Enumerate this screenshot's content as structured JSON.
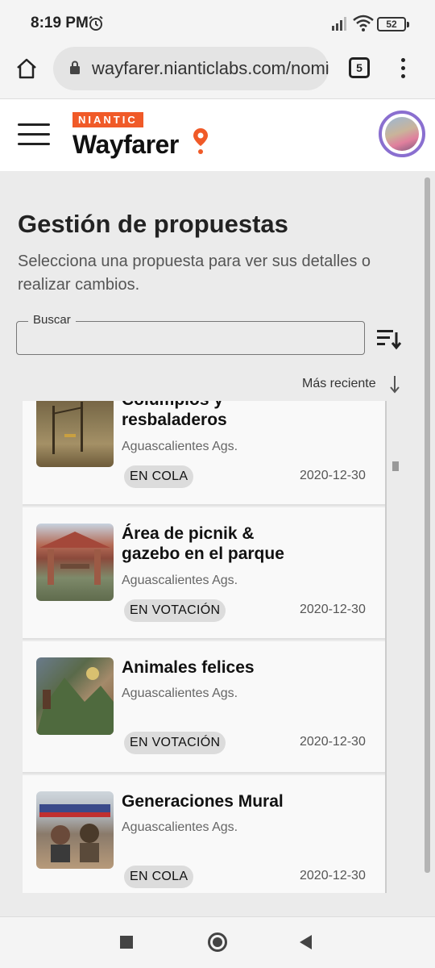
{
  "status_bar": {
    "time": "8:19 PM",
    "battery": "52"
  },
  "browser": {
    "url": "wayfarer.nianticlabs.com/nomi",
    "tab_count": "5"
  },
  "header": {
    "brand_top": "NIANTIC",
    "brand_name": "Wayfarer"
  },
  "page": {
    "title": "Gestión de propuestas",
    "subtitle": "Selecciona una propuesta para ver sus detalles o realizar cambios."
  },
  "search": {
    "label": "Buscar",
    "value": ""
  },
  "sort": {
    "label": "Más reciente"
  },
  "nominations": [
    {
      "title": "Columpios y resbaladeros",
      "location": "Aguascalientes Ags.",
      "status": "EN COLA",
      "date": "2020-12-30"
    },
    {
      "title": "Área de picnik & gazebo en el parque",
      "location": "Aguascalientes Ags.",
      "status": "EN VOTACIÓN",
      "date": "2020-12-30"
    },
    {
      "title": "Animales felices",
      "location": "Aguascalientes Ags.",
      "status": "EN VOTACIÓN",
      "date": "2020-12-30"
    },
    {
      "title": "Generaciones Mural",
      "location": "Aguascalientes Ags.",
      "status": "EN COLA",
      "date": "2020-12-30"
    }
  ],
  "colors": {
    "accent": "#f05a28",
    "avatar_ring": "#8a6fd0",
    "badge_bg": "#dcdcdc"
  },
  "icons": [
    "alarm-icon",
    "signal-icon",
    "wifi-icon",
    "home-icon",
    "lock-icon",
    "menu-dots-icon",
    "hamburger-icon",
    "pin-icon",
    "sort-icon",
    "arrow-down-icon"
  ]
}
